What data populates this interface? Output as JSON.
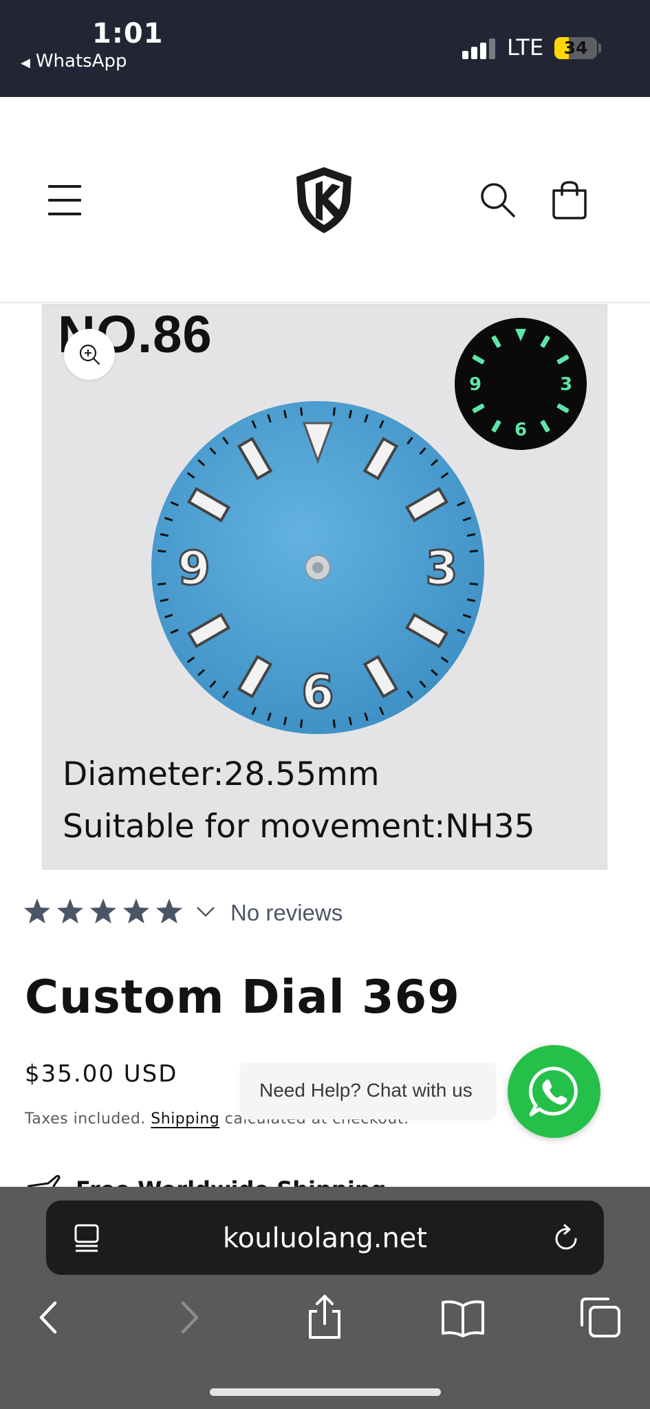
{
  "status_bar": {
    "time": "1:01",
    "back_app": "WhatsApp",
    "network": "LTE",
    "battery_level": "34",
    "battery_color": "#ffd60a"
  },
  "header": {
    "menu_icon": "hamburger-menu-icon",
    "logo_icon": "shield-k-logo",
    "search_icon": "search-icon",
    "cart_icon": "cart-bag-icon"
  },
  "product_image": {
    "model_label": "NO.86",
    "caption_line1": "Diameter:28.55mm",
    "caption_line2": "Suitable for movement:NH35",
    "dial_color": "#4ea0d2",
    "lume_color": "#5ee6a8",
    "zoom_icon": "zoom-in-icon",
    "numerals": [
      "3",
      "6",
      "9"
    ]
  },
  "reviews": {
    "rating_max": 5,
    "label": "No reviews",
    "star_color": "#4a5566"
  },
  "product": {
    "title": "Custom Dial 369",
    "price": "$35.00 USD",
    "tax_prefix": "Taxes included.",
    "shipping_link": "Shipping",
    "tax_suffix": "calculated at checkout.",
    "shipping_banner": "Free Worldwide Shipping"
  },
  "chat_widget": {
    "bubble_text": "Need Help? Chat with us",
    "button_color": "#25c04a",
    "icon": "whatsapp-icon"
  },
  "browser": {
    "url": "kouluolang.net",
    "reader_icon": "reader-mode-icon",
    "reload_icon": "reload-icon",
    "nav": {
      "back_icon": "back-arrow-icon",
      "forward_icon": "forward-arrow-icon",
      "share_icon": "share-icon",
      "bookmarks_icon": "bookmarks-book-icon",
      "tabs_icon": "tabs-icon"
    }
  }
}
